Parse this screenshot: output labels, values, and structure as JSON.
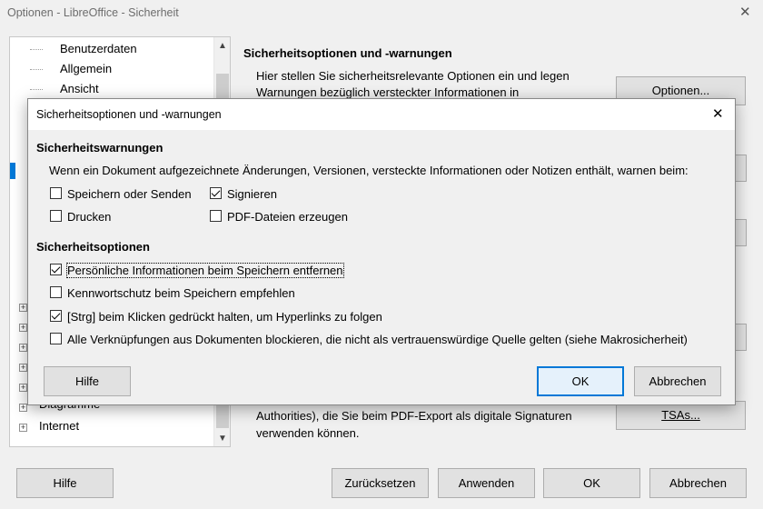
{
  "window": {
    "title": "Optionen - LibreOffice - Sicherheit",
    "close_glyph": "✕"
  },
  "tree": {
    "items": [
      {
        "label": "Benutzerdaten"
      },
      {
        "label": "Allgemein"
      },
      {
        "label": "Ansicht"
      },
      {
        "label": "Diagramme"
      },
      {
        "label": "Internet"
      }
    ]
  },
  "right_panel": {
    "heading": "Sicherheitsoptionen und -warnungen",
    "text_line1": "Hier stellen Sie sicherheitsrelevante Optionen ein und legen",
    "text_line2": "Warnungen bezüglich versteckter Informationen in",
    "options_button": "Optionen...",
    "bottom_line1": "Authorities), die Sie beim PDF-Export als digitale Signaturen",
    "bottom_line2": "verwenden können.",
    "tsas_button": "TSAs..."
  },
  "footer": {
    "help": "Hilfe",
    "reset": "Zurücksetzen",
    "apply": "Anwenden",
    "ok": "OK",
    "cancel": "Abbrechen"
  },
  "dialog": {
    "title": "Sicherheitsoptionen und -warnungen",
    "warnings_heading": "Sicherheitswarnungen",
    "warnings_desc": "Wenn ein Dokument aufgezeichnete Änderungen, Versionen, versteckte Informationen oder Notizen enthält, warnen beim:",
    "warn_save": {
      "label": "Speichern oder Senden",
      "checked": false
    },
    "warn_sign": {
      "label": "Signieren",
      "checked": true
    },
    "warn_print": {
      "label": "Drucken",
      "checked": false
    },
    "warn_pdf": {
      "label": "PDF-Dateien erzeugen",
      "checked": false
    },
    "options_heading": "Sicherheitsoptionen",
    "opt_remove_personal": {
      "label": "Persönliche Informationen beim Speichern entfernen",
      "checked": true
    },
    "opt_password": {
      "label": "Kennwortschutz beim Speichern empfehlen",
      "checked": false
    },
    "opt_ctrl_click": {
      "label": "[Strg] beim Klicken gedrückt halten, um Hyperlinks zu folgen",
      "checked": true
    },
    "opt_block_links": {
      "label": "Alle Verknüpfungen aus Dokumenten blockieren, die nicht als vertrauenswürdige Quelle gelten (siehe Makrosicherheit)",
      "checked": false
    },
    "help": "Hilfe",
    "ok": "OK",
    "cancel": "Abbrechen",
    "close_glyph": "✕"
  }
}
